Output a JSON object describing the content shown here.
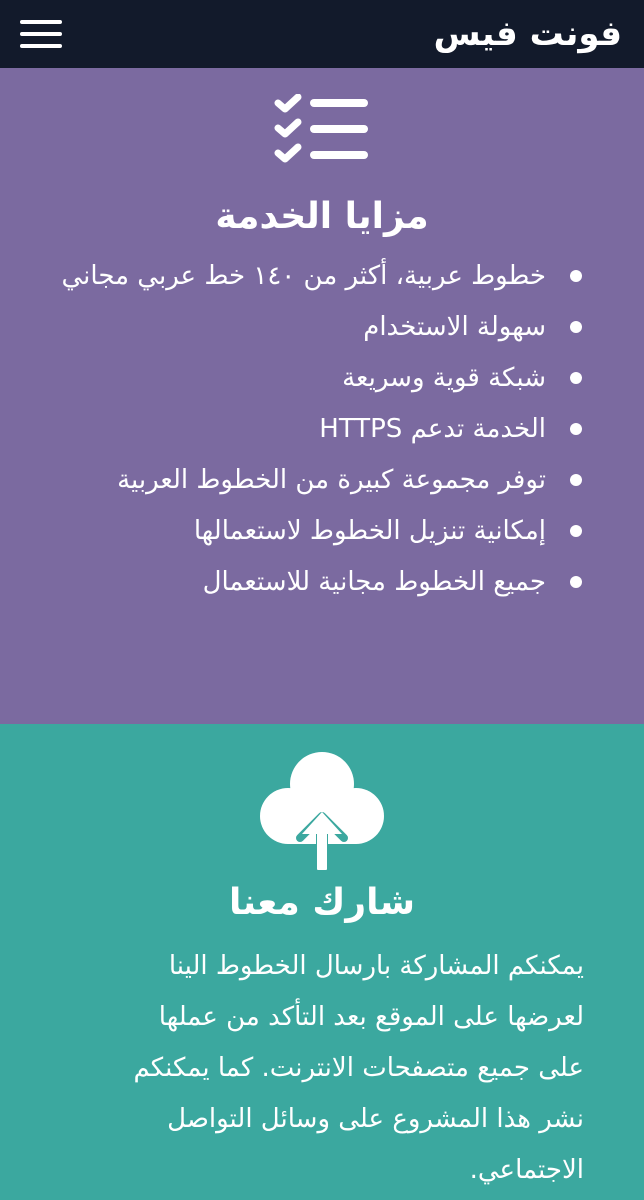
{
  "header": {
    "logo_text": "فونت فيس",
    "menu_icon": "hamburger-icon"
  },
  "features": {
    "icon": "checklist-icon",
    "title": "مزايا الخدمة",
    "items": [
      "خطوط عربية، أكثر من ١٤٠ خط عربي مجاني",
      "سهولة الاستخدام",
      "شبكة قوية وسريعة",
      "الخدمة تدعم HTTPS",
      "توفر مجموعة كبيرة من الخطوط العربية",
      "إمكانية تنزيل الخطوط لاستعمالها",
      "جميع الخطوط مجانية للاستعمال"
    ]
  },
  "share": {
    "icon": "cloud-upload-icon",
    "title": "شارك معنا",
    "text": "يمكنكم المشاركة بارسال الخطوط الينا لعرضها على الموقع بعد التأكد من عملها على جميع متصفحات الانترنت. كما يمكنكم نشر هذا المشروع على وسائل التواصل الاجتماعي."
  },
  "colors": {
    "header_bg": "#121a2b",
    "features_bg": "#7b6aa0",
    "share_bg": "#3ba89f",
    "text": "#ffffff"
  }
}
